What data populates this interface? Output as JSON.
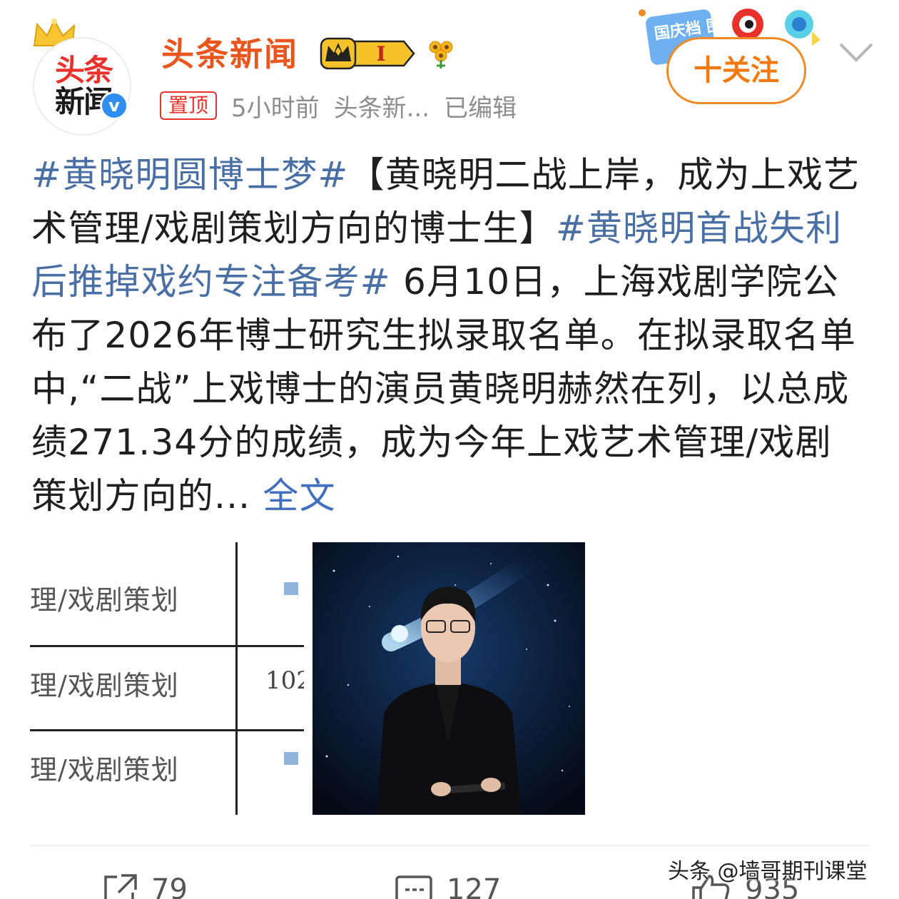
{
  "header": {
    "avatar_line1": "头条",
    "avatar_line2": "新闻",
    "verified_mark": "v",
    "author_name": "头条新闻",
    "member_level": "I",
    "pinned_label": "置顶",
    "time": "5小时前",
    "source": "头条新...",
    "edited": "已编辑",
    "festival_text": "国庆档 围观",
    "follow_label": "十关注"
  },
  "post": {
    "tag1": "#黄晓明圆博士梦#",
    "text1": "【黄晓明二战上岸，成为上戏艺术管理/戏剧策划方向的博士生】",
    "tag2": "#黄晓明首战失利后推掉戏约专注备考#",
    "text2": " 6月10日，上海戏剧学院公布了2026年博士研究生拟录取名单。在拟录取名单中,“二战”上戏博士的演员黄晓明赫然在列，以总成绩271.34分的成绩，成为今年上戏艺术管理/戏剧策划方向的...",
    "full_text_link": " 全文"
  },
  "images": {
    "table_rows": [
      "理/戏剧策划",
      "理/戏剧策划",
      "理/戏剧策划"
    ],
    "table_number": "102"
  },
  "actions": {
    "share_count": "79",
    "comment_count": "127",
    "like_count": "935"
  },
  "watermark": "头条 @墙哥期刊课堂",
  "colors": {
    "author": "#e8561e",
    "hashtag": "#4a6fa5",
    "follow": "#f07a10",
    "pinned": "#e8312a"
  }
}
